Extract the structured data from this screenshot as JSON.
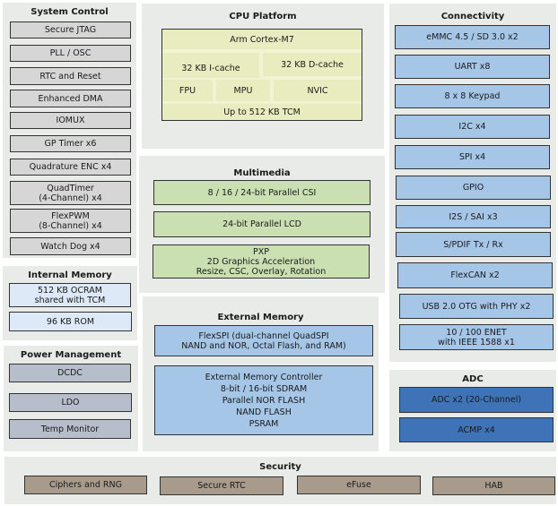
{
  "system_control": {
    "title": "System Control",
    "items": [
      "Secure JTAG",
      "PLL / OSC",
      "RTC and Reset",
      "Enhanced DMA",
      "IOMUX",
      "GP Timer x6",
      "Quadrature ENC x4",
      "QuadTimer\n(4-Channel) x4",
      "FlexPWM\n(8-Channel) x4",
      "Watch Dog x4"
    ]
  },
  "internal_memory": {
    "title": "Internal Memory",
    "items": [
      "512 KB OCRAM\nshared with TCM",
      "96 KB ROM"
    ]
  },
  "power_management": {
    "title": "Power Management",
    "items": [
      "DCDC",
      "LDO",
      "Temp Monitor"
    ]
  },
  "cpu_platform": {
    "title": "CPU Platform",
    "core": "Arm Cortex-M7",
    "icache": "32 KB I-cache",
    "dcache": "32 KB D-cache",
    "fpu": "FPU",
    "mpu": "MPU",
    "nvic": "NVIC",
    "tcm": "Up to 512 KB TCM"
  },
  "multimedia": {
    "title": "Multimedia",
    "items": [
      "8 / 16 / 24-bit Parallel CSI",
      "24-bit Parallel LCD",
      "PXP\n2D Graphics Acceleration\nResize, CSC, Overlay, Rotation"
    ]
  },
  "external_memory": {
    "title": "External Memory",
    "items": [
      "FlexSPI (dual-channel QuadSPI\nNAND and NOR, Octal Flash, and RAM)",
      "External Memory Controller\n8-bit / 16-bit SDRAM\nParallel NOR FLASH\nNAND FLASH\nPSRAM"
    ]
  },
  "connectivity": {
    "title": "Connectivity",
    "items": [
      "eMMC 4.5 / SD 3.0 x2",
      "UART x8",
      "8 x 8 Keypad",
      "I2C x4",
      "SPI x4",
      "GPIO",
      "I2S / SAI x3",
      "S/PDIF Tx / Rx",
      "FlexCAN x2",
      "USB 2.0 OTG with PHY x2",
      "10 / 100 ENET\nwith IEEE 1588 x1"
    ]
  },
  "adc": {
    "title": "ADC",
    "items": [
      "ADC x2 (20-Channel)",
      "ACMP x4"
    ]
  },
  "security": {
    "title": "Security",
    "items": [
      "Ciphers and RNG",
      "Secure RTC",
      "eFuse",
      "HAB"
    ]
  },
  "colors": {
    "panel": "#e9ebe9",
    "system_control": "#d6d6d6",
    "internal_memory": "#dde9f6",
    "power": "#b6bdcb",
    "cpu": "#e9ecbe",
    "multimedia": "#cadfb2",
    "memory_connectivity": "#a6c6e8",
    "adc": "#3e73b8",
    "security": "#a99b8b"
  }
}
